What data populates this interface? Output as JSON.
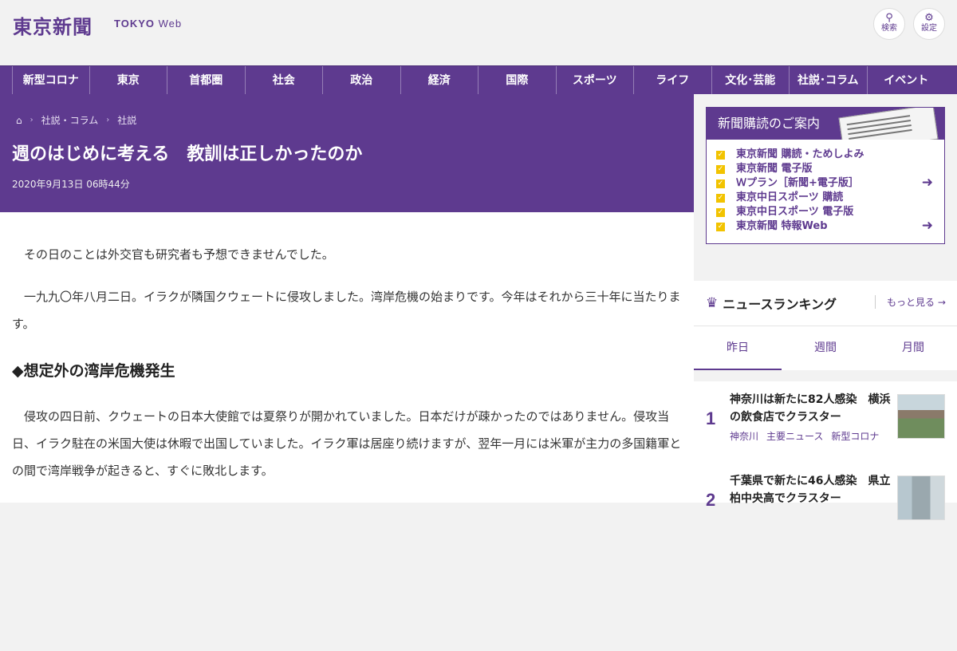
{
  "header": {
    "logo_jp": "東京新聞",
    "logo_en_bold": "TOKYO",
    "logo_en_light": "Web",
    "search_label": "検索",
    "settings_label": "設定"
  },
  "nav": {
    "items": [
      "新型コロナ",
      "東京",
      "首都圏",
      "社会",
      "政治",
      "経済",
      "国際",
      "スポーツ",
      "ライフ",
      "文化･芸能",
      "社説･コラム",
      "イベント"
    ]
  },
  "breadcrumb": {
    "items": [
      "社説・コラム",
      "社説"
    ]
  },
  "article": {
    "title": "週のはじめに考える　教訓は正しかったのか",
    "date": "2020年9月13日 06時44分",
    "paragraph1": "その日のことは外交官も研究者も予想できませんでした。",
    "paragraph2": "一九九〇年八月二日。イラクが隣国クウェートに侵攻しました。湾岸危機の始まりです。今年はそれから三十年に当たります。",
    "heading1": "◆想定外の湾岸危機発生",
    "paragraph3": "侵攻の四日前、クウェートの日本大使館では夏祭りが開かれていました。日本だけが疎かったのではありません。侵攻当日、イラク駐在の米国大使は休暇で出国していました。イラク軍は居座り続けますが、翌年一月には米軍が主力の多国籍軍との間で湾岸戦争が起きると、すぐに敗北します。"
  },
  "promo": {
    "title": "新聞購読のご案内",
    "items": [
      "東京新聞 購読・ためしよみ",
      "東京新聞 電子版",
      "Ｗプラン［新聞+電子版］",
      "東京中日スポーツ 購読",
      "東京中日スポーツ 電子版",
      "東京新聞 特報Web"
    ]
  },
  "ranking": {
    "title": "ニュースランキング",
    "more": "もっと見る",
    "tabs": [
      "昨日",
      "週間",
      "月間"
    ],
    "items": [
      {
        "rank": "1",
        "title": "神奈川は新たに82人感染　横浜の飲食店でクラスター",
        "tags": [
          "神奈川",
          "主要ニュース",
          "新型コロナ"
        ]
      },
      {
        "rank": "2",
        "title": "千葉県で新たに46人感染　県立柏中央高でクラスター",
        "tags": []
      }
    ]
  },
  "colors": {
    "brand": "#5e3a8f",
    "checkbox": "#f2c300"
  }
}
